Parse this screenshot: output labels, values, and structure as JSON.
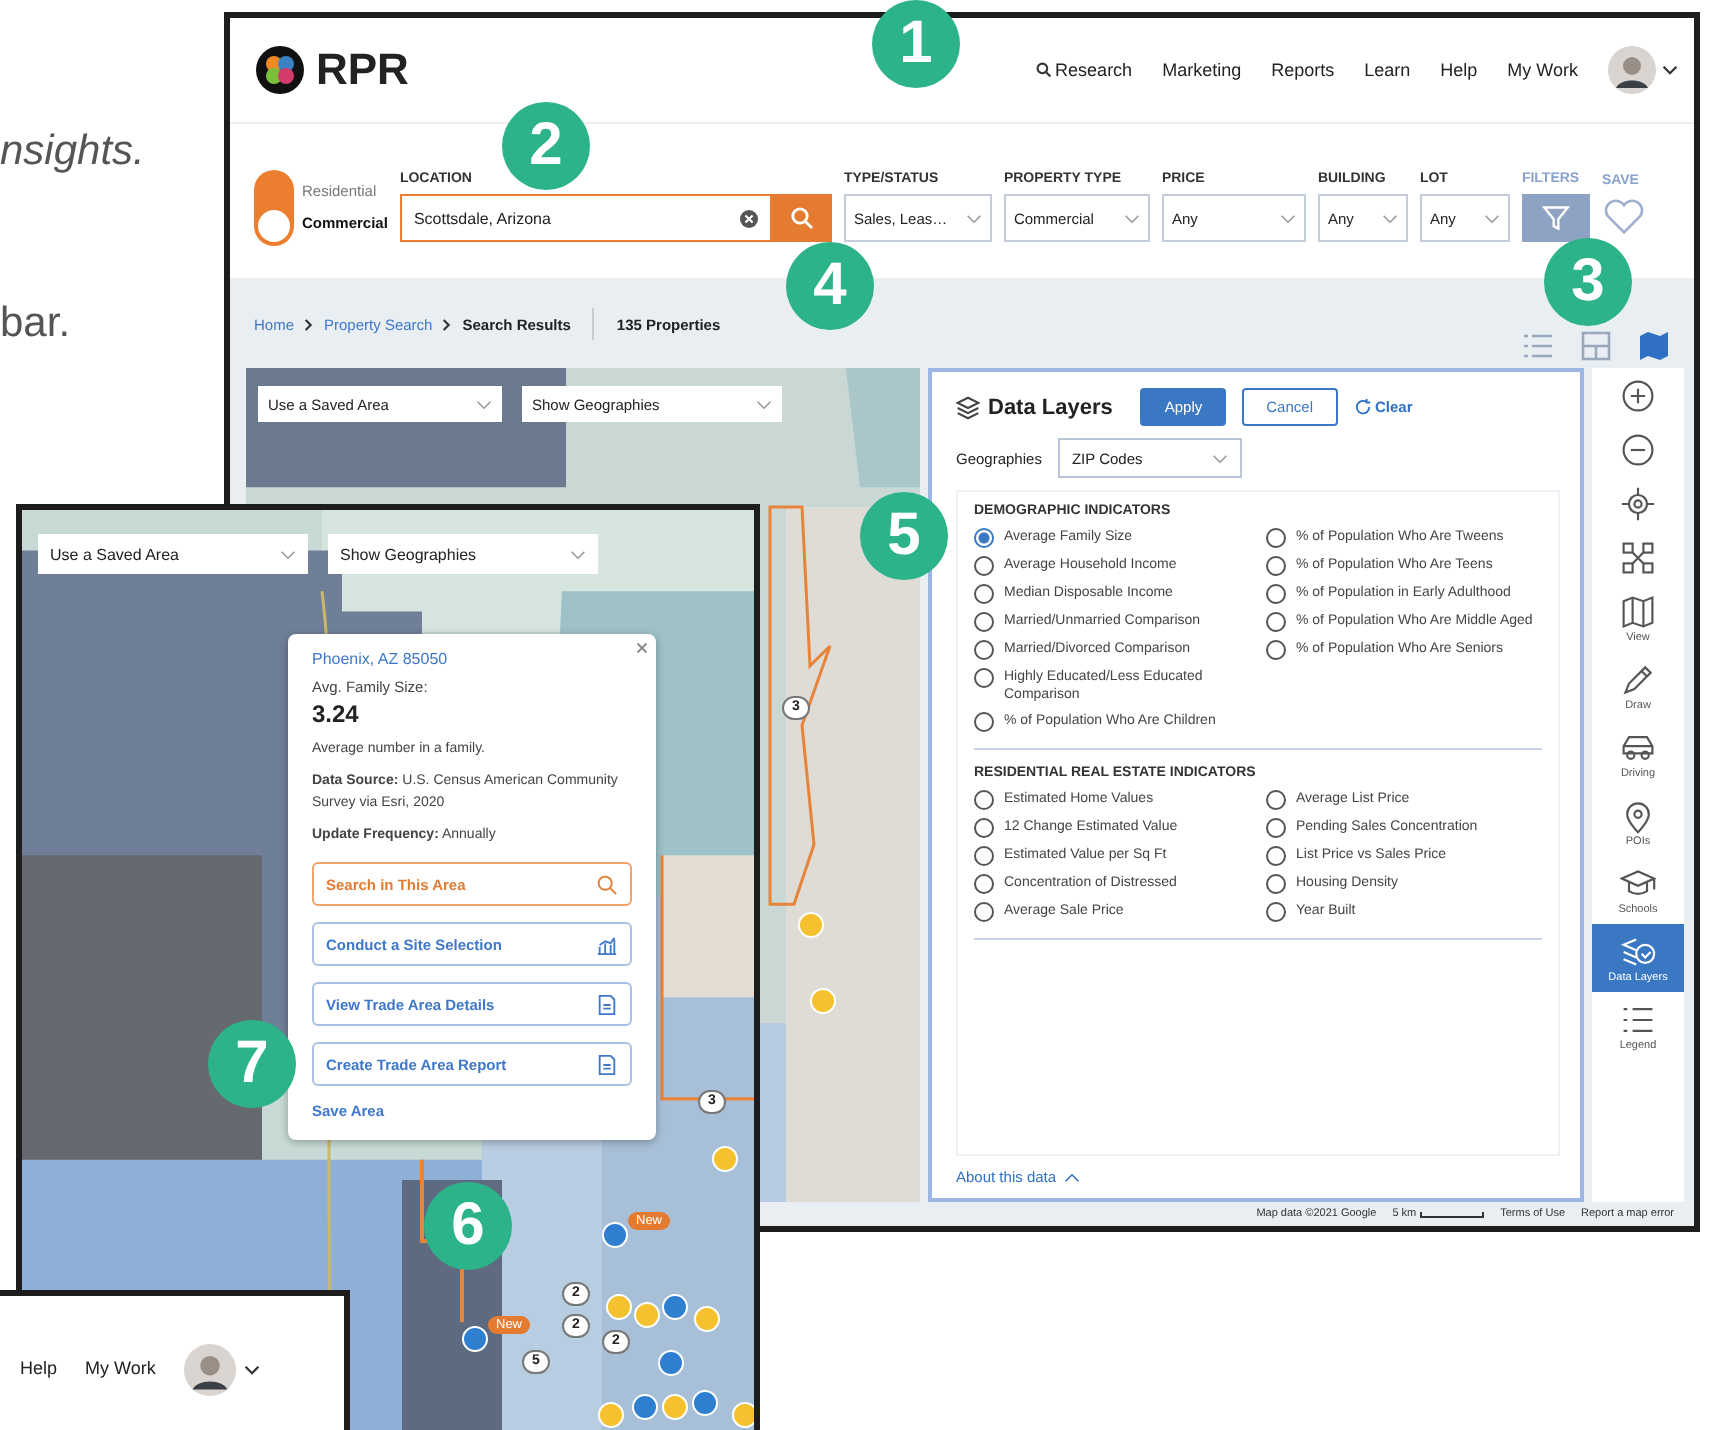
{
  "page_text": [
    "nsights.",
    "bar."
  ],
  "main_window": {
    "logo": "RPR",
    "nav": [
      {
        "label": "Research",
        "search_icon": true
      },
      {
        "label": "Marketing",
        "search_icon": false
      },
      {
        "label": "Reports",
        "search_icon": false
      },
      {
        "label": "Learn",
        "search_icon": false
      },
      {
        "label": "Help",
        "search_icon": false
      },
      {
        "label": "My Work",
        "search_icon": false
      }
    ],
    "property_toggle": [
      {
        "label": "Residential",
        "selected": false
      },
      {
        "label": "Commercial",
        "selected": true
      }
    ],
    "location": {
      "label": "LOCATION",
      "value": "Scottsdale, Arizona"
    },
    "dropdowns": [
      {
        "label": "TYPE/STATUS",
        "value": "Sales, Leas…"
      },
      {
        "label": "PROPERTY TYPE",
        "value": "Commercial"
      },
      {
        "label": "PRICE",
        "value": "Any"
      },
      {
        "label": "BUILDING",
        "value": "Any"
      },
      {
        "label": "LOT",
        "value": "Any"
      }
    ],
    "filters_label": "FILTERS",
    "save_label": "SAVE",
    "breadcrumbs": [
      {
        "label": "Home",
        "current": false
      },
      {
        "label": "Property Search",
        "current": false
      },
      {
        "label": "Search Results",
        "current": true
      }
    ],
    "result_count": "135 Properties",
    "view_buttons": [
      {
        "kind": "list",
        "selected": false
      },
      {
        "kind": "grid",
        "selected": false
      },
      {
        "kind": "map",
        "selected": true
      }
    ],
    "map": {
      "dropdowns": [
        "Use a Saved Area",
        "Show Geographies"
      ],
      "markers": [
        {
          "kind": "cluster",
          "label": "3"
        },
        {
          "kind": "dot",
          "color": "#f5c12e"
        },
        {
          "kind": "dot",
          "color": "#f5c12e"
        }
      ]
    },
    "data_layers": {
      "title": "Data Layers",
      "apply": "Apply",
      "cancel": "Cancel",
      "clear": "Clear",
      "geographies_label": "Geographies",
      "geographies_value": "ZIP Codes",
      "sections": [
        {
          "title": "DEMOGRAPHIC INDICATORS",
          "columns": [
            [
              {
                "label": "Average Family Size",
                "selected": true
              },
              {
                "label": "Average Household Income",
                "selected": false
              },
              {
                "label": "Median Disposable Income",
                "selected": false
              },
              {
                "label": "Married/Unmarried Comparison",
                "selected": false
              },
              {
                "label": "Married/Divorced Comparison",
                "selected": false
              },
              {
                "label": "Highly Educated/Less Educated Comparison",
                "selected": false
              },
              {
                "label": "% of Population Who Are Children",
                "selected": false
              }
            ],
            [
              {
                "label": "% of Population Who Are Tweens",
                "selected": false
              },
              {
                "label": "% of Population Who Are Teens",
                "selected": false
              },
              {
                "label": "% of Population in Early Adulthood",
                "selected": false
              },
              {
                "label": "% of Population Who Are Middle Aged",
                "selected": false
              },
              {
                "label": "% of Population Who Are Seniors",
                "selected": false
              }
            ]
          ]
        },
        {
          "title": "RESIDENTIAL REAL ESTATE INDICATORS",
          "columns": [
            [
              {
                "label": "Estimated Home Values",
                "selected": false
              },
              {
                "label": "12 Change Estimated Value",
                "selected": false
              },
              {
                "label": "Estimated Value per Sq Ft",
                "selected": false
              },
              {
                "label": "Concentration of Distressed",
                "selected": false
              },
              {
                "label": "Average Sale Price",
                "selected": false
              }
            ],
            [
              {
                "label": "Average List Price",
                "selected": false
              },
              {
                "label": "Pending Sales Concentration",
                "selected": false
              },
              {
                "label": "List Price vs Sales Price",
                "selected": false
              },
              {
                "label": "Housing Density",
                "selected": false
              },
              {
                "label": "Year Built",
                "selected": false
              }
            ]
          ]
        }
      ],
      "about": "About this data"
    },
    "tools": [
      {
        "kind": "zoom-in",
        "selected": false
      },
      {
        "kind": "zoom-out",
        "selected": false
      },
      {
        "kind": "locate",
        "selected": false
      },
      {
        "kind": "cluster",
        "selected": false
      },
      {
        "kind": "view",
        "label": "View",
        "selected": false
      },
      {
        "kind": "draw",
        "label": "Draw",
        "selected": false
      },
      {
        "kind": "driving",
        "label": "Driving",
        "selected": false
      },
      {
        "kind": "pois",
        "label": "POIs",
        "selected": false
      },
      {
        "kind": "schools",
        "label": "Schools",
        "selected": false
      },
      {
        "kind": "layers",
        "label": "Data Layers",
        "selected": true
      },
      {
        "kind": "legend",
        "label": "Legend",
        "selected": false
      }
    ],
    "map_footer": {
      "attribution": "Map data ©2021 Google",
      "scale": "5 km",
      "terms": "Terms of Use",
      "report": "Report a map error"
    }
  },
  "inset_window": {
    "dropdowns": [
      "Use a Saved Area",
      "Show Geographies"
    ],
    "popup": {
      "title": "Phoenix, AZ 85050",
      "metric_label": "Avg. Family Size:",
      "metric_value": "3.24",
      "description": "Average number in a family.",
      "source": "**Data Source:** U.S. Census American Community Survey via Esri, 2020",
      "frequency": "**Update Frequency:** Annually",
      "actions": [
        {
          "label": "Search in This Area",
          "kind": "search"
        },
        {
          "label": "Conduct a Site Selection",
          "kind": "chart"
        },
        {
          "label": "View Trade Area Details",
          "kind": "document"
        },
        {
          "label": "Create Trade Area Report",
          "kind": "document"
        }
      ],
      "save": "Save Area"
    },
    "markers": [
      {
        "kind": "cluster",
        "label": "3"
      },
      {
        "kind": "dot",
        "color": "#f5c12e"
      },
      {
        "kind": "dot",
        "color": "#2f7fd1"
      },
      {
        "kind": "new",
        "label": "New"
      },
      {
        "kind": "dot",
        "color": "#2f7fd1"
      },
      {
        "kind": "new",
        "label": "New"
      },
      {
        "kind": "dot",
        "color": "#f5c12e"
      },
      {
        "kind": "dot",
        "color": "#f5c12e"
      },
      {
        "kind": "dot",
        "color": "#2f7fd1"
      },
      {
        "kind": "dot",
        "color": "#f5c12e"
      },
      {
        "kind": "cluster",
        "label": "2"
      },
      {
        "kind": "cluster",
        "label": "2"
      },
      {
        "kind": "cluster",
        "label": "2"
      },
      {
        "kind": "cluster",
        "label": "5"
      },
      {
        "kind": "dot",
        "color": "#2f7fd1"
      },
      {
        "kind": "dot",
        "color": "#2f7fd1"
      },
      {
        "kind": "dot",
        "color": "#f5c12e"
      },
      {
        "kind": "dot",
        "color": "#2f7fd1"
      },
      {
        "kind": "dot",
        "color": "#f5c12e"
      },
      {
        "kind": "dot",
        "color": "#f5c12e"
      }
    ]
  },
  "bottom_window": {
    "nav": [
      "Help",
      "My Work"
    ]
  },
  "callouts": [
    "1",
    "2",
    "3",
    "4",
    "5",
    "6",
    "7"
  ]
}
